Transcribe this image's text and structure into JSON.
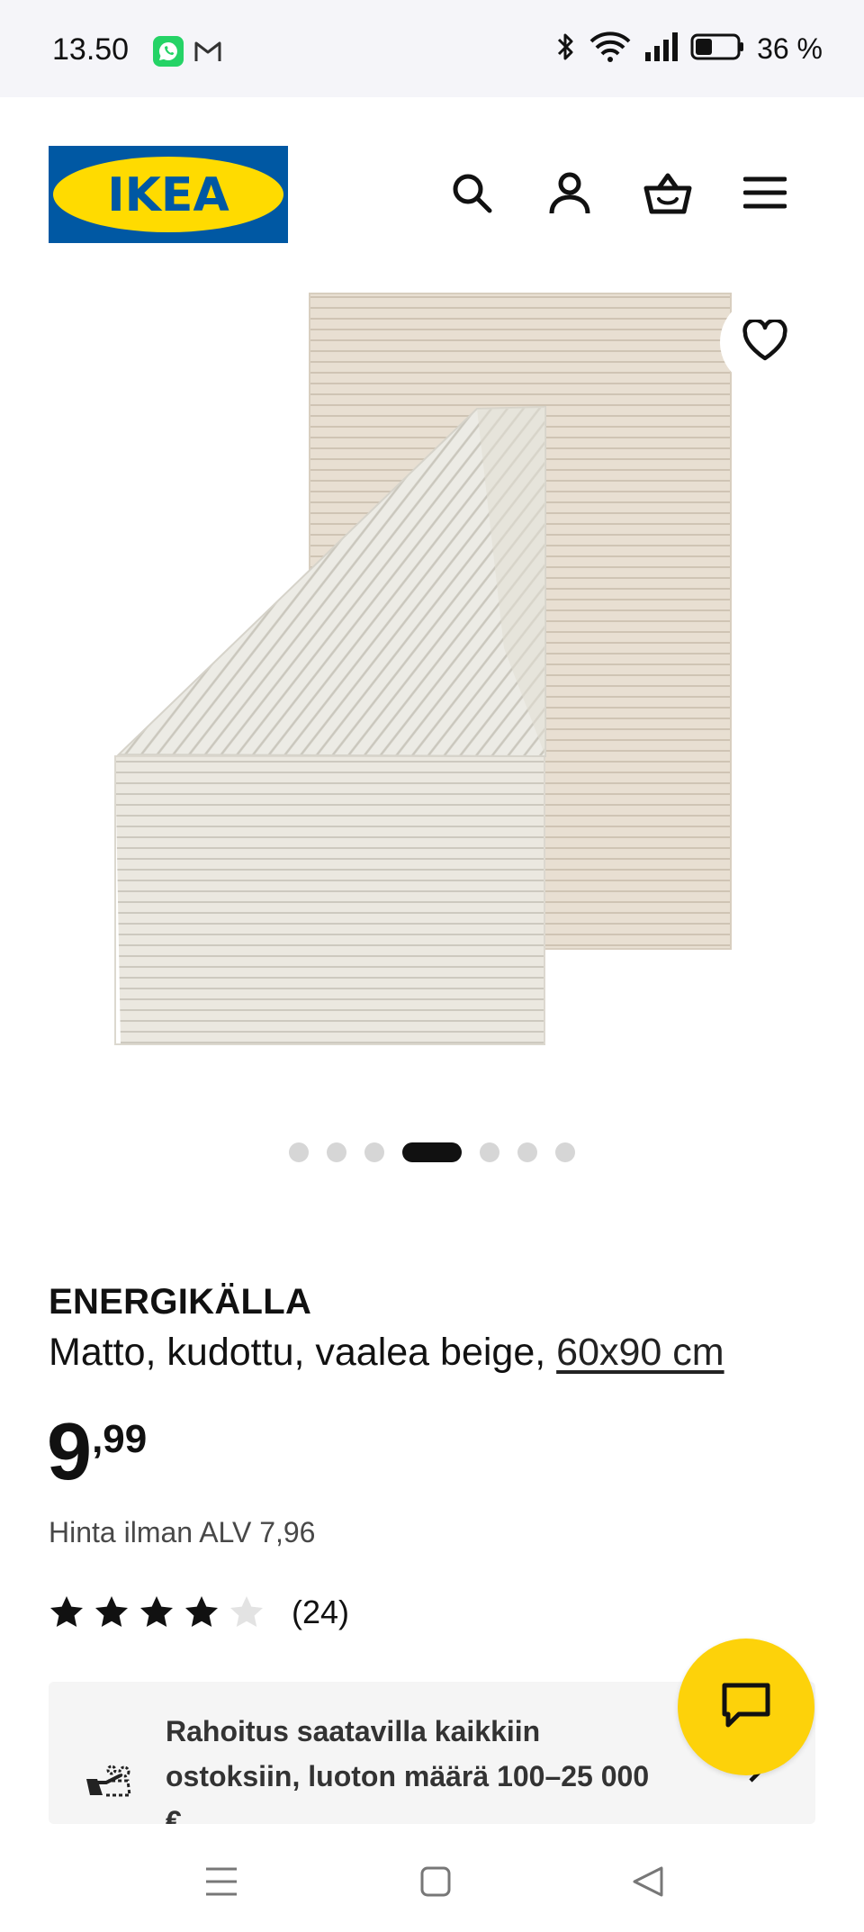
{
  "status_bar": {
    "time": "13.50",
    "battery_percent": "36 %",
    "icons": [
      "whatsapp-icon",
      "gmail-icon",
      "bluetooth-icon",
      "wifi-icon",
      "signal-icon",
      "battery-icon"
    ]
  },
  "header": {
    "logo_text": "IKEA",
    "icons": [
      "search-icon",
      "account-icon",
      "basket-icon",
      "menu-icon"
    ]
  },
  "gallery": {
    "image_count": 7,
    "active_index": 3
  },
  "product": {
    "name": "ENERGIKÄLLA",
    "description": "Matto, kudottu, vaalea beige,",
    "size": "60x90 cm",
    "price_integer": "9",
    "price_decimal": ",99",
    "vat_text": "Hinta ilman ALV 7,96",
    "rating": 4,
    "rating_max": 5,
    "review_count": "(24)"
  },
  "finance": {
    "line1": "Rahoitus saatavilla kaikkiin",
    "line2": "ostoksiin, luoton määrä 100–25 000",
    "line3": "€"
  },
  "colors": {
    "ikea_blue": "#0058a3",
    "ikea_yellow": "#ffdb00",
    "fab_yellow": "#fdd20a",
    "text": "#111111"
  }
}
